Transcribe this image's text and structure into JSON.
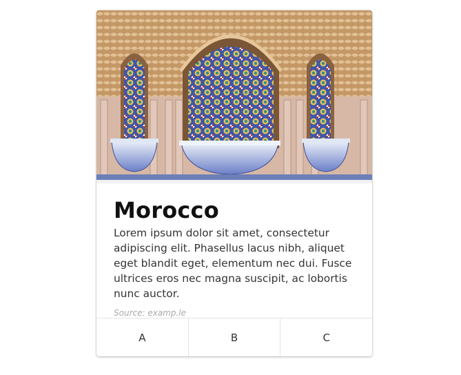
{
  "card": {
    "image_alt": "Mosaic fountain",
    "title": "Morocco",
    "description": "Lorem ipsum dolor sit amet, consectetur adipiscing elit. Phasellus lacus nibh, aliquet eget blandit eget, elementum nec dui. Fusce ultrices eros nec magna suscipit, ac lobortis nunc auctor.",
    "source": "Source: examp.le",
    "buttons": [
      "A",
      "B",
      "C"
    ]
  },
  "colors": {
    "wall": "#c9a27a",
    "tile_blue": "#4a5fb3",
    "accent_orange": "#d89a46",
    "title_text": "#111111",
    "muted_text": "#a9a9a9"
  }
}
